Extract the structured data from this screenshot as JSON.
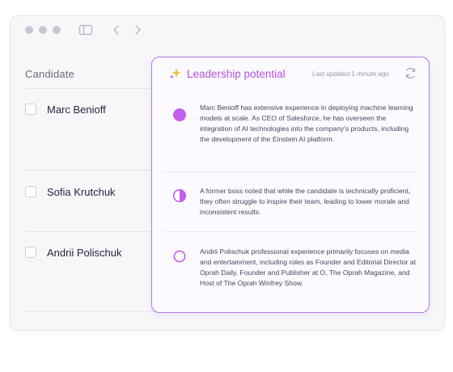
{
  "colors": {
    "accent": "#b550e0",
    "panel_border": "#b478e6",
    "indicator": "#c25ef0",
    "window_dots": "#c9c6d6"
  },
  "toolbar": {
    "icons": [
      "window-dot-icon",
      "window-dot-icon",
      "window-dot-icon",
      "sidebar-toggle-icon",
      "chevron-left-icon",
      "chevron-right-icon"
    ]
  },
  "table": {
    "candidate_header": "Candidate",
    "candidates": [
      {
        "name": "Marc Benioff"
      },
      {
        "name": "Sofia Krutchuk"
      },
      {
        "name": "Andrii Polischuk"
      }
    ]
  },
  "panel": {
    "icon": "sparkle-icon",
    "title": "Leadership potential",
    "updated": "Last updated 1 minute ago",
    "refresh_icon": "refresh-icon",
    "entries": [
      {
        "indicator": "full",
        "text": "Marc Benioff has extensive experience in deploying machine learning models at scale. As CEO of Salesforce, he has overseen the integration of AI technologies into the company's products, including the development of the Einstein AI platform."
      },
      {
        "indicator": "half",
        "text": "A former boss noted that while the candidate is technically proficient, they often struggle to inspire their team, leading to lower morale and inconsistent results."
      },
      {
        "indicator": "empty",
        "text": "Andrii Polischuk professional experience primarily focuses on media and entertainment, including roles as Founder and Editorial Director at Oprah Daily, Founder and Publisher at O, The Oprah Magazine, and Host of The Oprah Winfrey Show."
      }
    ]
  }
}
